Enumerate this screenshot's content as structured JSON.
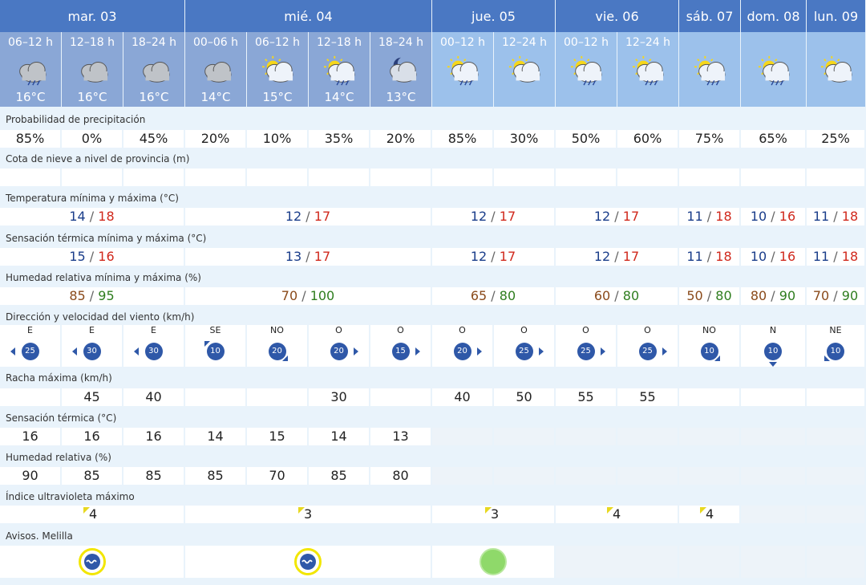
{
  "days": [
    "mar. 03",
    "mié. 04",
    "jue. 05",
    "vie. 06",
    "sáb. 07",
    "dom. 08",
    "lun. 09"
  ],
  "periods": [
    {
      "label": "06–12 h",
      "temp": "16°C",
      "icon": "cloud-rain-icon"
    },
    {
      "label": "12–18 h",
      "temp": "16°C",
      "icon": "cloud-icon"
    },
    {
      "label": "18–24 h",
      "temp": "16°C",
      "icon": "cloud-icon"
    },
    {
      "label": "00–06 h",
      "temp": "14°C",
      "icon": "cloud-icon"
    },
    {
      "label": "06–12 h",
      "temp": "15°C",
      "icon": "sun-cloud-icon"
    },
    {
      "label": "12–18 h",
      "temp": "14°C",
      "icon": "sun-cloud-rain-icon"
    },
    {
      "label": "18–24 h",
      "temp": "13°C",
      "icon": "moon-cloud-icon"
    },
    {
      "label": "00–12 h",
      "temp": "",
      "icon": "sun-cloud-rain-icon"
    },
    {
      "label": "12–24 h",
      "temp": "",
      "icon": "sun-cloud-icon"
    },
    {
      "label": "00–12 h",
      "temp": "",
      "icon": "sun-cloud-rain-icon"
    },
    {
      "label": "12–24 h",
      "temp": "",
      "icon": "sun-cloud-rain-icon"
    },
    {
      "label": "",
      "temp": "",
      "icon": "sun-cloud-rain-icon"
    },
    {
      "label": "",
      "temp": "",
      "icon": "sun-cloud-rain-icon"
    },
    {
      "label": "",
      "temp": "",
      "icon": "sun-cloud-icon"
    }
  ],
  "labels": {
    "precip": "Probabilidad de precipitación",
    "snow": "Cota de nieve a nivel de provincia (m)",
    "temp": "Temperatura mínima y máxima (°C)",
    "feel": "Sensación térmica mínima y máxima (°C)",
    "hum": "Humedad relativa mínima y máxima (%)",
    "wind": "Dirección y velocidad del viento (km/h)",
    "gust": "Racha máxima (km/h)",
    "feelh": "Sensación térmica (°C)",
    "humh": "Humedad relativa (%)",
    "uv": "Índice ultravioleta máximo",
    "warn": "Avisos. Melilla"
  },
  "precip": [
    "85%",
    "0%",
    "45%",
    "20%",
    "10%",
    "35%",
    "20%",
    "85%",
    "30%",
    "50%",
    "60%",
    "75%",
    "65%",
    "25%"
  ],
  "temp_minmax": [
    [
      "14",
      "18"
    ],
    [
      "12",
      "17"
    ],
    [
      "12",
      "17"
    ],
    [
      "12",
      "17"
    ],
    [
      "11",
      "18"
    ],
    [
      "10",
      "16"
    ],
    [
      "11",
      "18"
    ]
  ],
  "feel_minmax": [
    [
      "15",
      "16"
    ],
    [
      "13",
      "17"
    ],
    [
      "12",
      "17"
    ],
    [
      "12",
      "17"
    ],
    [
      "11",
      "18"
    ],
    [
      "10",
      "16"
    ],
    [
      "11",
      "18"
    ]
  ],
  "hum_minmax": [
    [
      "85",
      "95"
    ],
    [
      "70",
      "100"
    ],
    [
      "65",
      "80"
    ],
    [
      "60",
      "80"
    ],
    [
      "50",
      "80"
    ],
    [
      "80",
      "90"
    ],
    [
      "70",
      "90"
    ]
  ],
  "wind": [
    {
      "dir": "E",
      "speed": "25"
    },
    {
      "dir": "E",
      "speed": "30"
    },
    {
      "dir": "E",
      "speed": "30"
    },
    {
      "dir": "SE",
      "speed": "10"
    },
    {
      "dir": "NO",
      "speed": "20"
    },
    {
      "dir": "O",
      "speed": "20"
    },
    {
      "dir": "O",
      "speed": "15"
    },
    {
      "dir": "O",
      "speed": "20"
    },
    {
      "dir": "O",
      "speed": "25"
    },
    {
      "dir": "O",
      "speed": "25"
    },
    {
      "dir": "O",
      "speed": "25"
    },
    {
      "dir": "NO",
      "speed": "10"
    },
    {
      "dir": "N",
      "speed": "10"
    },
    {
      "dir": "NE",
      "speed": "10"
    }
  ],
  "gust": [
    "",
    "45",
    "40",
    "",
    "",
    "30",
    "",
    "40",
    "50",
    "55",
    "55",
    "",
    "",
    ""
  ],
  "feel_hourly": [
    "16",
    "16",
    "16",
    "14",
    "15",
    "14",
    "13"
  ],
  "hum_hourly": [
    "90",
    "85",
    "85",
    "85",
    "70",
    "85",
    "80"
  ],
  "uv": [
    "4",
    "3",
    "3",
    "4",
    "4",
    "",
    ""
  ],
  "colors": {
    "day_header": "#4a78c3",
    "warning_yellow": "#f2e600",
    "warning_green": "#8fd96a"
  }
}
